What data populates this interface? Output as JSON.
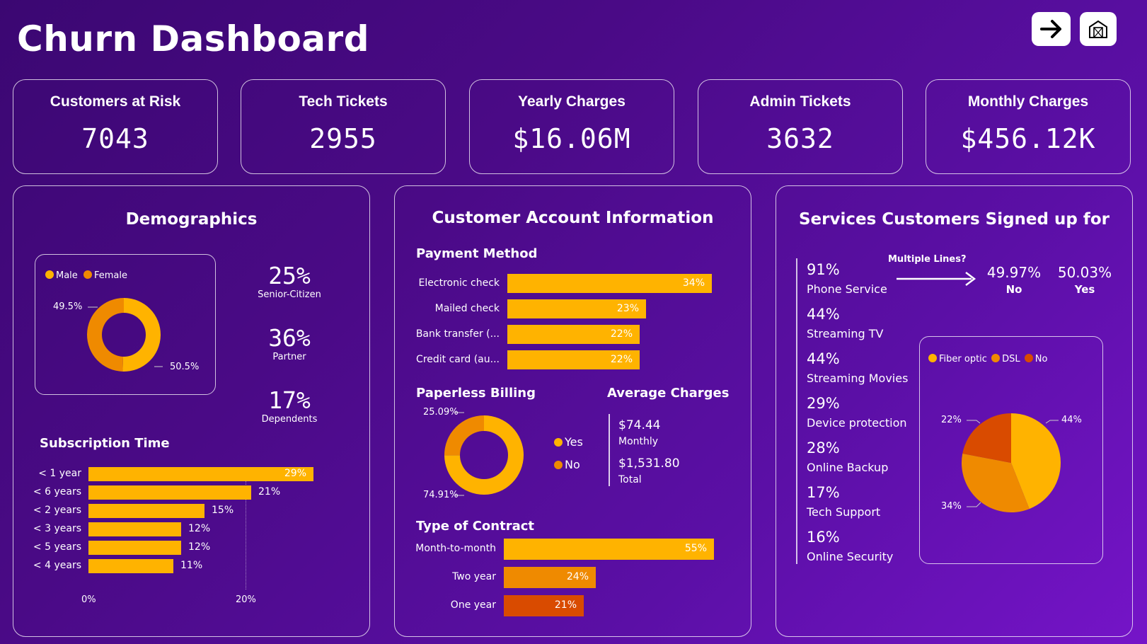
{
  "title": "Churn Dashboard",
  "colors": {
    "yellow": "#FFB300",
    "orange": "#EF8A00",
    "red": "#D94B00",
    "bg": "#4a0a86"
  },
  "buttons": {
    "next_icon": "arrow-right-icon",
    "home_icon": "building-icon"
  },
  "kpis": [
    {
      "label": "Customers at Risk",
      "value": "7043"
    },
    {
      "label": "Tech Tickets",
      "value": "2955"
    },
    {
      "label": "Yearly Charges",
      "value": "$16.06M"
    },
    {
      "label": "Admin Tickets",
      "value": "3632"
    },
    {
      "label": "Monthly Charges",
      "value": "$456.12K"
    }
  ],
  "demographics": {
    "title": "Demographics",
    "gender": {
      "legend": [
        "Male",
        "Female"
      ],
      "slices": [
        {
          "name": "Male",
          "pct": 50.5,
          "label": "50.5%"
        },
        {
          "name": "Female",
          "pct": 49.5,
          "label": "49.5%"
        }
      ]
    },
    "stats": [
      {
        "value": "25%",
        "label": "Senior-Citizen"
      },
      {
        "value": "36%",
        "label": "Partner"
      },
      {
        "value": "17%",
        "label": "Dependents"
      }
    ],
    "subscription": {
      "title": "Subscription Time",
      "rows": [
        {
          "label": "< 1 year",
          "value": 29,
          "text": "29%"
        },
        {
          "label": "< 6 years",
          "value": 21,
          "text": "21%"
        },
        {
          "label": "< 2 years",
          "value": 15,
          "text": "15%"
        },
        {
          "label": "< 3 years",
          "value": 12,
          "text": "12%"
        },
        {
          "label": "< 5 years",
          "value": 12,
          "text": "12%"
        },
        {
          "label": "< 4 years",
          "value": 11,
          "text": "11%"
        }
      ],
      "axis": [
        "0%",
        "20%"
      ]
    }
  },
  "account": {
    "title": "Customer Account Information",
    "payment": {
      "title": "Payment Method",
      "rows": [
        {
          "label": "Electronic check",
          "value": 34,
          "text": "34%"
        },
        {
          "label": "Mailed check",
          "value": 23,
          "text": "23%"
        },
        {
          "label": "Bank transfer (...",
          "value": 22,
          "text": "22%"
        },
        {
          "label": "Credit card (au...",
          "value": 22,
          "text": "22%"
        }
      ]
    },
    "paperless": {
      "title": "Paperless Billing",
      "slices": [
        {
          "name": "Yes",
          "pct": 74.91,
          "label": "74.91%"
        },
        {
          "name": "No",
          "pct": 25.09,
          "label": "25.09%"
        }
      ],
      "legend": [
        "Yes",
        "No"
      ]
    },
    "average": {
      "title": "Average Charges",
      "monthly_value": "$74.44",
      "monthly_label": "Monthly",
      "total_value": "$1,531.80",
      "total_label": "Total"
    },
    "contract": {
      "title": "Type of Contract",
      "rows": [
        {
          "label": "Month-to-month",
          "value": 55,
          "text": "55%"
        },
        {
          "label": "Two year",
          "value": 24,
          "text": "24%"
        },
        {
          "label": "One year",
          "value": 21,
          "text": "21%"
        }
      ]
    }
  },
  "services": {
    "title": "Services Customers Signed up for",
    "list": [
      {
        "pct": "91%",
        "name": "Phone Service"
      },
      {
        "pct": "44%",
        "name": "Streaming TV"
      },
      {
        "pct": "44%",
        "name": "Streaming Movies"
      },
      {
        "pct": "29%",
        "name": "Device protection"
      },
      {
        "pct": "28%",
        "name": "Online Backup"
      },
      {
        "pct": "17%",
        "name": "Tech Support"
      },
      {
        "pct": "16%",
        "name": "Online Security"
      }
    ],
    "multiple_lines": {
      "question": "Multiple Lines?",
      "no_value": "49.97%",
      "no_label": "No",
      "yes_value": "50.03%",
      "yes_label": "Yes"
    },
    "internet": {
      "legend": [
        "Fiber optic",
        "DSL",
        "No"
      ],
      "slices": [
        {
          "name": "Fiber optic",
          "pct": 44,
          "label": "44%"
        },
        {
          "name": "DSL",
          "pct": 34,
          "label": "34%"
        },
        {
          "name": "No",
          "pct": 22,
          "label": "22%"
        }
      ]
    }
  }
}
